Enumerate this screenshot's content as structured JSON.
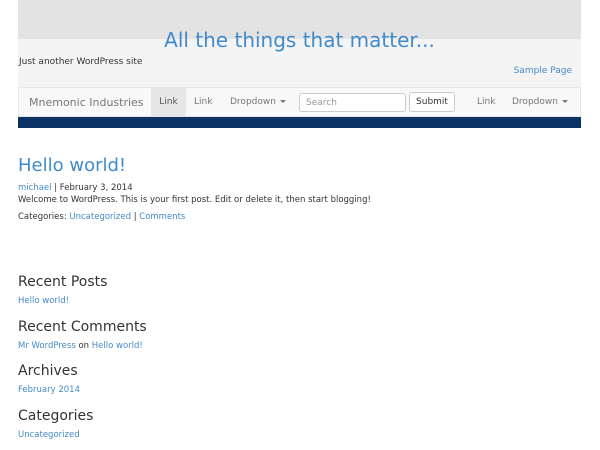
{
  "header": {
    "title": "All the things that matter...",
    "tagline": "Just another WordPress site",
    "sample_page": "Sample Page"
  },
  "navbar": {
    "brand": "Mnemonic Industries",
    "items": [
      {
        "label": "Link"
      },
      {
        "label": "Link"
      },
      {
        "label": "Dropdown"
      },
      {
        "label": "Link"
      },
      {
        "label": "Dropdown"
      }
    ],
    "search": {
      "placeholder": "Search",
      "value": ""
    },
    "submit_label": "Submit"
  },
  "post": {
    "title": "Hello world!",
    "author": "michael",
    "separator": "|",
    "date": "February 3, 2014",
    "body": "Welcome to WordPress. This is your first post. Edit or delete it, then start blogging!",
    "categories_label": "Categories:",
    "category": "Uncategorized",
    "comments_link": "Comments"
  },
  "sidebar": {
    "recent_posts": {
      "heading": "Recent Posts",
      "items": [
        "Hello world!"
      ]
    },
    "recent_comments": {
      "heading": "Recent Comments",
      "items": [
        {
          "author": "Mr WordPress",
          "on": "on",
          "post": "Hello world!"
        }
      ]
    },
    "archives": {
      "heading": "Archives",
      "items": [
        "February 2014"
      ]
    },
    "categories": {
      "heading": "Categories",
      "items": [
        "Uncategorized"
      ]
    }
  },
  "colors": {
    "link": "#428bca",
    "header_bg": "#e3e3e3",
    "navbar_bg": "#f8f8f8",
    "underbar": "#0b3366"
  }
}
